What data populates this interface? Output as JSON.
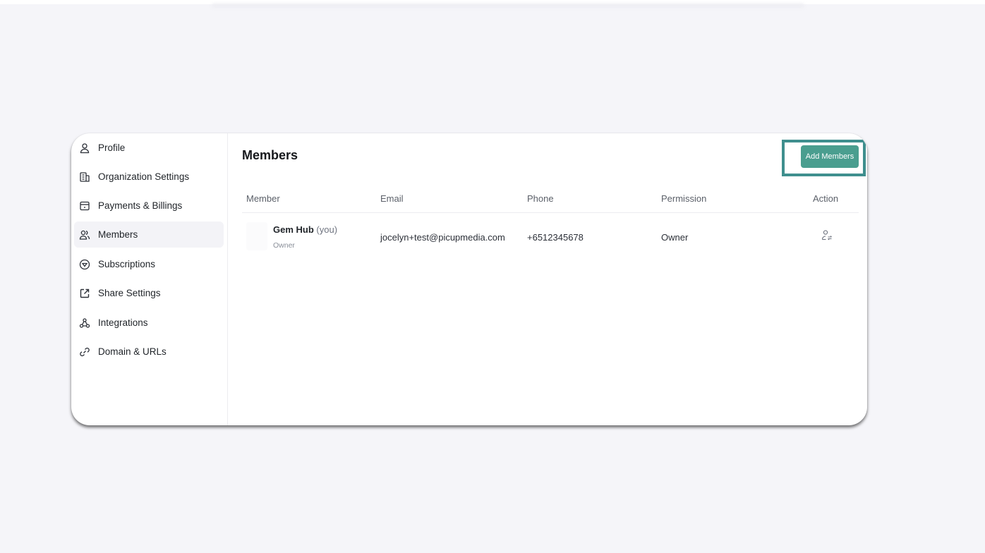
{
  "sidebar": {
    "items": [
      {
        "label": "Profile",
        "icon": "user-icon"
      },
      {
        "label": "Organization Settings",
        "icon": "building-icon"
      },
      {
        "label": "Payments & Billings",
        "icon": "wallet-icon"
      },
      {
        "label": "Members",
        "icon": "users-icon",
        "active": true
      },
      {
        "label": "Subscriptions",
        "icon": "diamond-icon"
      },
      {
        "label": "Share Settings",
        "icon": "external-link-icon"
      },
      {
        "label": "Integrations",
        "icon": "webhook-icon"
      },
      {
        "label": "Domain & URLs",
        "icon": "link-icon"
      }
    ]
  },
  "main": {
    "title": "Members",
    "add_button_label": "Add Members",
    "table": {
      "columns": [
        "Member",
        "Email",
        "Phone",
        "Permission",
        "Action"
      ],
      "rows": [
        {
          "name": "Gem Hub",
          "you_tag": "(you)",
          "role": "Owner",
          "email": "jocelyn+test@picupmedia.com",
          "phone": "+6512345678",
          "permission": "Owner",
          "action_icon": "user-switch-icon"
        }
      ]
    }
  },
  "colors": {
    "accent": "#4a9e8f",
    "highlight": "#3f8f8e",
    "background": "#f5f5f9"
  }
}
